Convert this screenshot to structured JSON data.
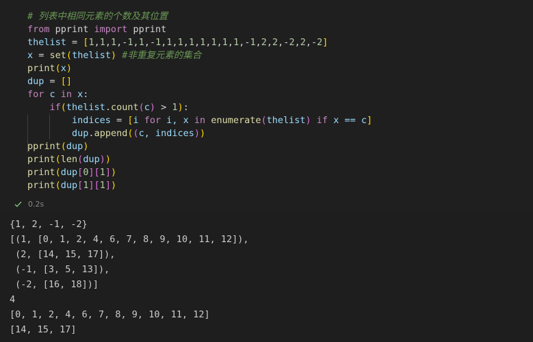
{
  "code_cell": {
    "lines": [
      [
        {
          "t": "# 列表中相同元素的个数及其位置",
          "c": "comment"
        }
      ],
      [
        {
          "t": "from",
          "c": "kw"
        },
        {
          "t": " pprint ",
          "c": "plain"
        },
        {
          "t": "import",
          "c": "kw"
        },
        {
          "t": " pprint",
          "c": "plain"
        }
      ],
      [
        {
          "t": "thelist",
          "c": "var"
        },
        {
          "t": " = ",
          "c": "op"
        },
        {
          "t": "[",
          "c": "b1"
        },
        {
          "t": "1",
          "c": "num"
        },
        {
          "t": ",",
          "c": "op"
        },
        {
          "t": "1",
          "c": "num"
        },
        {
          "t": ",",
          "c": "op"
        },
        {
          "t": "1",
          "c": "num"
        },
        {
          "t": ",-",
          "c": "op"
        },
        {
          "t": "1",
          "c": "num"
        },
        {
          "t": ",",
          "c": "op"
        },
        {
          "t": "1",
          "c": "num"
        },
        {
          "t": ",-",
          "c": "op"
        },
        {
          "t": "1",
          "c": "num"
        },
        {
          "t": ",",
          "c": "op"
        },
        {
          "t": "1",
          "c": "num"
        },
        {
          "t": ",",
          "c": "op"
        },
        {
          "t": "1",
          "c": "num"
        },
        {
          "t": ",",
          "c": "op"
        },
        {
          "t": "1",
          "c": "num"
        },
        {
          "t": ",",
          "c": "op"
        },
        {
          "t": "1",
          "c": "num"
        },
        {
          "t": ",",
          "c": "op"
        },
        {
          "t": "1",
          "c": "num"
        },
        {
          "t": ",",
          "c": "op"
        },
        {
          "t": "1",
          "c": "num"
        },
        {
          "t": ",",
          "c": "op"
        },
        {
          "t": "1",
          "c": "num"
        },
        {
          "t": ",-",
          "c": "op"
        },
        {
          "t": "1",
          "c": "num"
        },
        {
          "t": ",",
          "c": "op"
        },
        {
          "t": "2",
          "c": "num"
        },
        {
          "t": ",",
          "c": "op"
        },
        {
          "t": "2",
          "c": "num"
        },
        {
          "t": ",-",
          "c": "op"
        },
        {
          "t": "2",
          "c": "num"
        },
        {
          "t": ",",
          "c": "op"
        },
        {
          "t": "2",
          "c": "num"
        },
        {
          "t": ",-",
          "c": "op"
        },
        {
          "t": "2",
          "c": "num"
        },
        {
          "t": "]",
          "c": "b1"
        }
      ],
      [
        {
          "t": "x",
          "c": "var"
        },
        {
          "t": " = ",
          "c": "op"
        },
        {
          "t": "set",
          "c": "fn"
        },
        {
          "t": "(",
          "c": "b1"
        },
        {
          "t": "thelist",
          "c": "var"
        },
        {
          "t": ")",
          "c": "b1"
        },
        {
          "t": " ",
          "c": "plain"
        },
        {
          "t": "#非重复元素的集合",
          "c": "comment"
        }
      ],
      [
        {
          "t": "print",
          "c": "fn"
        },
        {
          "t": "(",
          "c": "b1"
        },
        {
          "t": "x",
          "c": "var"
        },
        {
          "t": ")",
          "c": "b1"
        }
      ],
      [
        {
          "t": "dup",
          "c": "var"
        },
        {
          "t": " = ",
          "c": "op"
        },
        {
          "t": "[]",
          "c": "b1"
        }
      ],
      [
        {
          "t": "for",
          "c": "ctrl"
        },
        {
          "t": " c ",
          "c": "var"
        },
        {
          "t": "in",
          "c": "ctrl"
        },
        {
          "t": " x:",
          "c": "var"
        }
      ],
      [
        {
          "t": "    ",
          "c": "plain"
        },
        {
          "t": "if",
          "c": "ctrl"
        },
        {
          "t": "(",
          "c": "b1"
        },
        {
          "t": "thelist",
          "c": "var"
        },
        {
          "t": ".",
          "c": "op"
        },
        {
          "t": "count",
          "c": "fn"
        },
        {
          "t": "(",
          "c": "b2"
        },
        {
          "t": "c",
          "c": "var"
        },
        {
          "t": ")",
          "c": "b2"
        },
        {
          "t": " > ",
          "c": "op"
        },
        {
          "t": "1",
          "c": "num"
        },
        {
          "t": ")",
          "c": "b1"
        },
        {
          "t": ":",
          "c": "op"
        }
      ],
      [
        {
          "t": "        ",
          "c": "plain"
        },
        {
          "t": "indices",
          "c": "var"
        },
        {
          "t": " = ",
          "c": "op"
        },
        {
          "t": "[",
          "c": "b1"
        },
        {
          "t": "i ",
          "c": "var"
        },
        {
          "t": "for",
          "c": "ctrl"
        },
        {
          "t": " i, x ",
          "c": "var"
        },
        {
          "t": "in",
          "c": "ctrl"
        },
        {
          "t": " ",
          "c": "plain"
        },
        {
          "t": "enumerate",
          "c": "fn"
        },
        {
          "t": "(",
          "c": "b2"
        },
        {
          "t": "thelist",
          "c": "var"
        },
        {
          "t": ")",
          "c": "b2"
        },
        {
          "t": " ",
          "c": "plain"
        },
        {
          "t": "if",
          "c": "ctrl"
        },
        {
          "t": " x == c",
          "c": "var"
        },
        {
          "t": "]",
          "c": "b1"
        }
      ],
      [
        {
          "t": "        ",
          "c": "plain"
        },
        {
          "t": "dup",
          "c": "var"
        },
        {
          "t": ".",
          "c": "op"
        },
        {
          "t": "append",
          "c": "fn"
        },
        {
          "t": "(",
          "c": "b1"
        },
        {
          "t": "(",
          "c": "b2"
        },
        {
          "t": "c, indices",
          "c": "var"
        },
        {
          "t": ")",
          "c": "b2"
        },
        {
          "t": ")",
          "c": "b1"
        }
      ],
      [
        {
          "t": "pprint",
          "c": "fn"
        },
        {
          "t": "(",
          "c": "b1"
        },
        {
          "t": "dup",
          "c": "var"
        },
        {
          "t": ")",
          "c": "b1"
        }
      ],
      [
        {
          "t": "print",
          "c": "fn"
        },
        {
          "t": "(",
          "c": "b1"
        },
        {
          "t": "len",
          "c": "fn"
        },
        {
          "t": "(",
          "c": "b2"
        },
        {
          "t": "dup",
          "c": "var"
        },
        {
          "t": ")",
          "c": "b2"
        },
        {
          "t": ")",
          "c": "b1"
        }
      ],
      [
        {
          "t": "print",
          "c": "fn"
        },
        {
          "t": "(",
          "c": "b1"
        },
        {
          "t": "dup",
          "c": "var"
        },
        {
          "t": "[",
          "c": "b2"
        },
        {
          "t": "0",
          "c": "num"
        },
        {
          "t": "]",
          "c": "b2"
        },
        {
          "t": "[",
          "c": "b2"
        },
        {
          "t": "1",
          "c": "num"
        },
        {
          "t": "]",
          "c": "b2"
        },
        {
          "t": ")",
          "c": "b1"
        }
      ],
      [
        {
          "t": "print",
          "c": "fn"
        },
        {
          "t": "(",
          "c": "b1"
        },
        {
          "t": "dup",
          "c": "var"
        },
        {
          "t": "[",
          "c": "b2"
        },
        {
          "t": "1",
          "c": "num"
        },
        {
          "t": "]",
          "c": "b2"
        },
        {
          "t": "[",
          "c": "b2"
        },
        {
          "t": "1",
          "c": "num"
        },
        {
          "t": "]",
          "c": "b2"
        },
        {
          "t": ")",
          "c": "b1"
        }
      ]
    ]
  },
  "status": {
    "icon": "check-icon",
    "duration": "0.2s",
    "color": "#89d185"
  },
  "output": {
    "lines": [
      "{1, 2, -1, -2}",
      "[(1, [0, 1, 2, 4, 6, 7, 8, 9, 10, 11, 12]),",
      " (2, [14, 15, 17]),",
      " (-1, [3, 5, 13]),",
      " (-2, [16, 18])]",
      "4",
      "[0, 1, 2, 4, 6, 7, 8, 9, 10, 11, 12]",
      "[14, 15, 17]"
    ]
  }
}
